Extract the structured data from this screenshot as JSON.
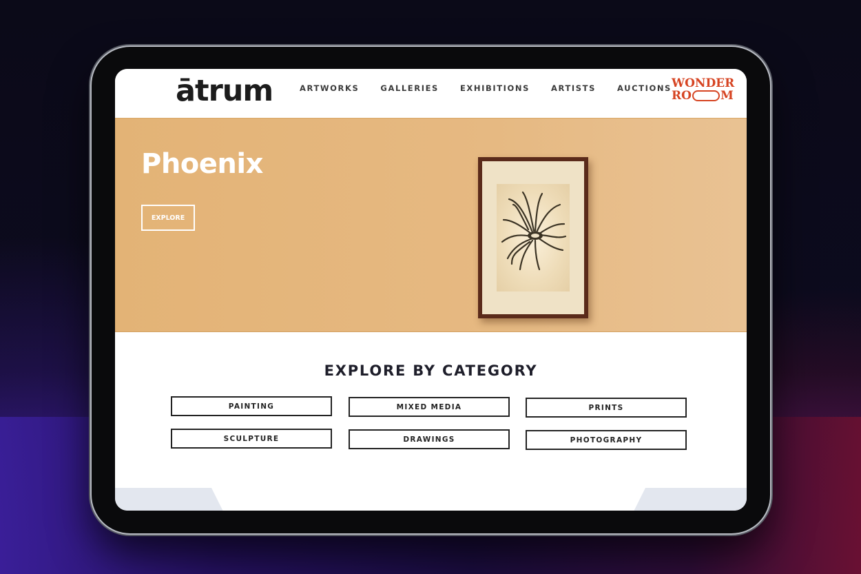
{
  "brand": {
    "logo_text": "ātrum",
    "partner_line1": "WONDER",
    "partner_line2_a": "RO",
    "partner_line2_b": "M"
  },
  "nav": {
    "items": [
      "ARTWORKS",
      "GALLERIES",
      "EXHIBITIONS",
      "ARTISTS",
      "AUCTIONS"
    ]
  },
  "hero": {
    "title": "Phoenix",
    "button_label": "EXPLORE",
    "background_color": "#e4b77c"
  },
  "categories": {
    "title": "EXPLORE BY CATEGORY",
    "items": [
      "PAINTING",
      "MIXED MEDIA",
      "PRINTS",
      "SCULPTURE",
      "DRAWINGS",
      "PHOTOGRAPHY"
    ]
  },
  "colors": {
    "accent": "#d64422",
    "text": "#1e1e2a"
  }
}
